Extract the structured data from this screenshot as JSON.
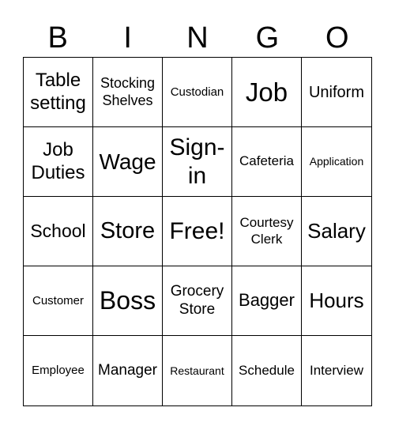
{
  "header": [
    "B",
    "I",
    "N",
    "G",
    "O"
  ],
  "cells": [
    "Table setting",
    "Stocking Shelves",
    "Custodian",
    "Job",
    "Uniform",
    "Job Duties",
    "Wage",
    "Sign-in",
    "Cafeteria",
    "Application",
    "School",
    "Store",
    "Free!",
    "Courtesy Clerk",
    "Salary",
    "Customer",
    "Boss",
    "Grocery Store",
    "Bagger",
    "Hours",
    "Employee",
    "Manager",
    "Restaurant",
    "Schedule",
    "Interview"
  ]
}
